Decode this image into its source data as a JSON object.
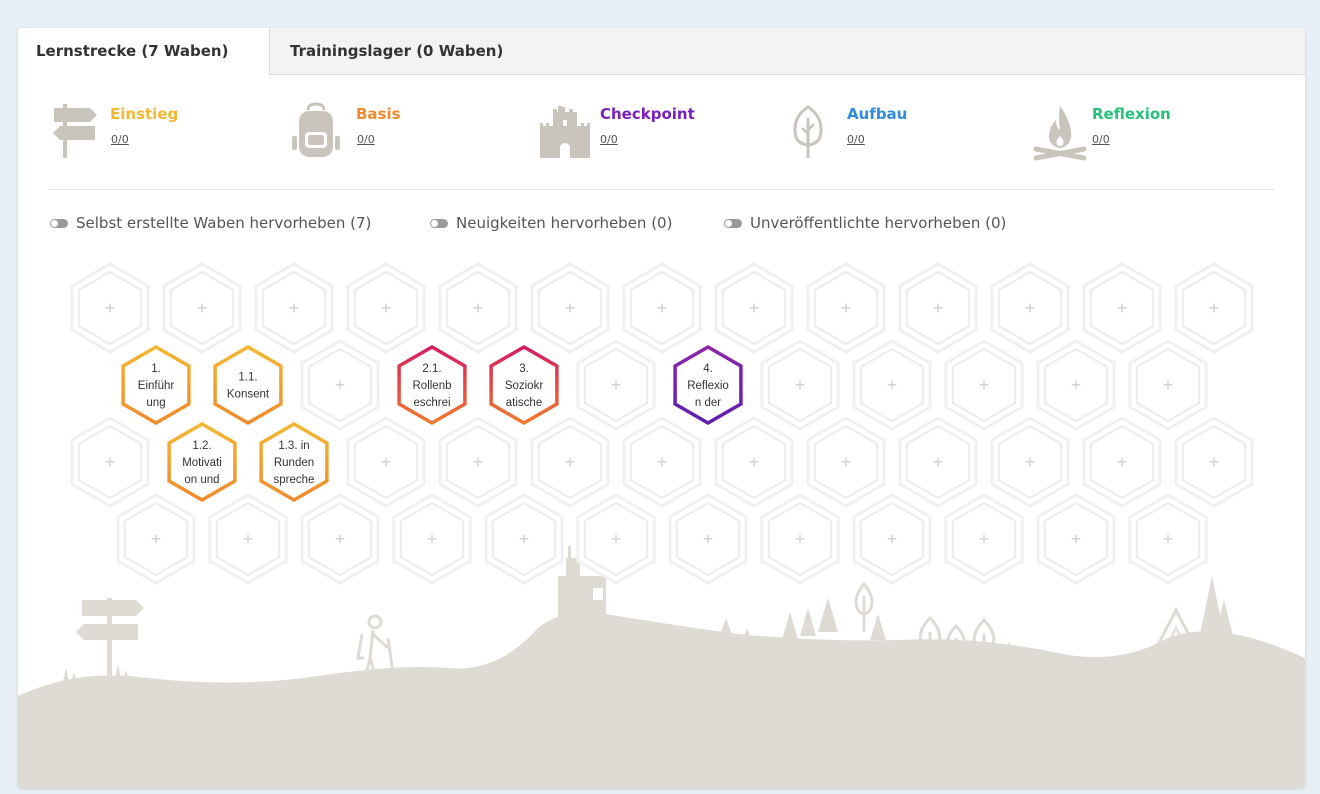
{
  "tabs": [
    {
      "label": "Lernstrecke (7 Waben)",
      "active": true
    },
    {
      "label": "Trainingslager (0 Waben)",
      "active": false
    }
  ],
  "categories": [
    {
      "name": "Einstieg",
      "count": "0/0",
      "color": "#f5b731",
      "icon": "signpost-icon"
    },
    {
      "name": "Basis",
      "count": "0/0",
      "color": "#f08a2c",
      "icon": "backpack-icon"
    },
    {
      "name": "Checkpoint",
      "count": "0/0",
      "color": "#7b1fbf",
      "icon": "castle-icon"
    },
    {
      "name": "Aufbau",
      "count": "0/0",
      "color": "#2f8be0",
      "icon": "tree-icon"
    },
    {
      "name": "Reflexion",
      "count": "0/0",
      "color": "#27c27a",
      "icon": "campfire-icon"
    }
  ],
  "toggles": [
    {
      "label": "Selbst erstellte Waben hervorheben (7)"
    },
    {
      "label": "Neuigkeiten hervorheben (0)"
    },
    {
      "label": "Unveröffentlichte hervorheben (0)"
    }
  ],
  "empty_cell_symbol": "+",
  "cells": [
    {
      "lines": [
        "1.",
        "Einführ",
        "ung"
      ],
      "gradient": [
        "#f5b731",
        "#f08a2c"
      ]
    },
    {
      "lines": [
        "1.1.",
        "Konsent"
      ],
      "gradient": [
        "#f5b731",
        "#f08a2c"
      ]
    },
    {
      "lines": [
        "1.2.",
        "Motivati",
        "on und"
      ],
      "gradient": [
        "#f5b731",
        "#f08a2c"
      ]
    },
    {
      "lines": [
        "1.3. in",
        "Runden",
        "spreche"
      ],
      "gradient": [
        "#f5b731",
        "#f08a2c"
      ]
    },
    {
      "lines": [
        "2.1.",
        "Rollenb",
        "eschrei"
      ],
      "gradient": [
        "#d81b60",
        "#f07a2c"
      ]
    },
    {
      "lines": [
        "3.",
        "Soziokr",
        "atische"
      ],
      "gradient": [
        "#d81b60",
        "#f07a2c"
      ]
    },
    {
      "lines": [
        "4.",
        "Reflexio",
        "n der"
      ],
      "gradient": [
        "#8e24aa",
        "#5e1fb0"
      ]
    }
  ]
}
